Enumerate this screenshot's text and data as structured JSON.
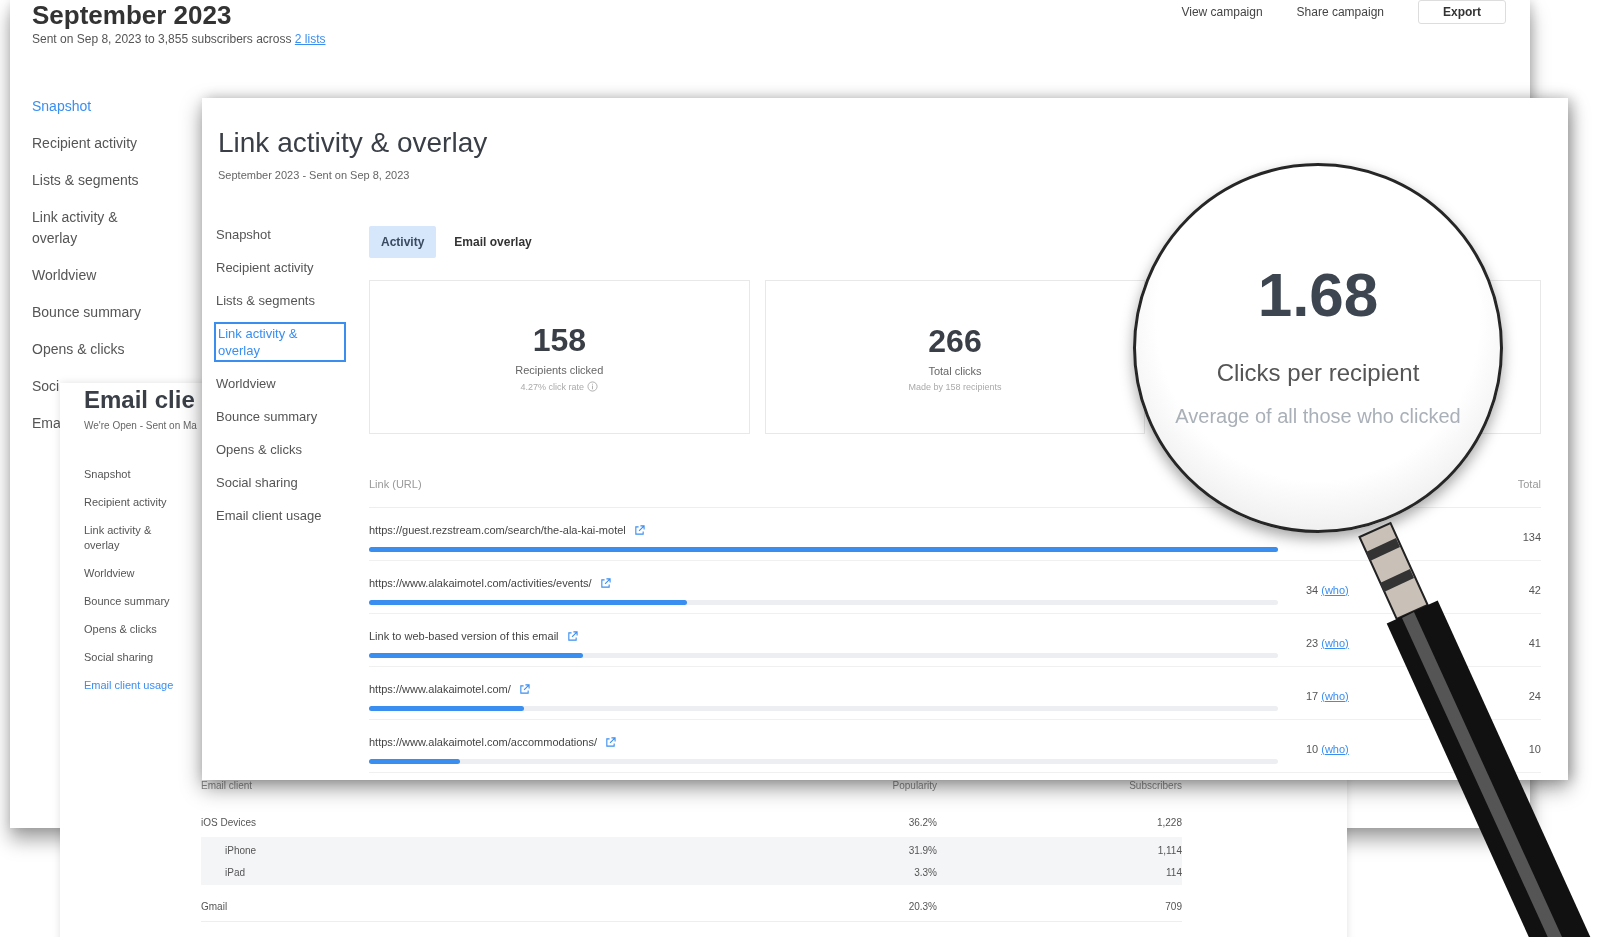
{
  "campaign_report": {
    "title": "September 2023",
    "subtitle": "Sent on Sep 8, 2023 to 3,855 subscribers across ",
    "subtitle_link": "2 lists",
    "actions": [
      "View campaign",
      "Share campaign"
    ],
    "export_button": "Export",
    "nav": [
      {
        "label": "Snapshot",
        "selected": true
      },
      {
        "label": "Recipient activity",
        "selected": false
      },
      {
        "label": "Lists & segments",
        "selected": false
      },
      {
        "label": "Link activity & overlay",
        "selected": false
      },
      {
        "label": "Worldview",
        "selected": false
      },
      {
        "label": "Bounce summary",
        "selected": false
      },
      {
        "label": "Opens & clicks",
        "selected": false
      },
      {
        "label": "Soci",
        "selected": false
      },
      {
        "label": "Ema",
        "selected": false
      }
    ]
  },
  "email_client_report": {
    "title": "Email clie",
    "subtitle": "We're Open - Sent on Ma",
    "nav": [
      {
        "label": "Snapshot",
        "selected": false
      },
      {
        "label": "Recipient activity",
        "selected": false
      },
      {
        "label": "Link activity & overlay",
        "selected": false
      },
      {
        "label": "Worldview",
        "selected": false
      },
      {
        "label": "Bounce summary",
        "selected": false
      },
      {
        "label": "Opens & clicks",
        "selected": false
      },
      {
        "label": "Social sharing",
        "selected": false
      },
      {
        "label": "Email client usage",
        "selected": true
      }
    ],
    "table": {
      "columns": [
        "Email client",
        "Popularity",
        "Subscribers"
      ],
      "rows": [
        {
          "client": "iOS Devices",
          "popularity": "36.2%",
          "subscribers": "1,228",
          "children": [
            {
              "client": "iPhone",
              "popularity": "31.9%",
              "subscribers": "1,114"
            },
            {
              "client": "iPad",
              "popularity": "3.3%",
              "subscribers": "114"
            }
          ]
        },
        {
          "client": "Gmail",
          "popularity": "20.3%",
          "subscribers": "709"
        }
      ]
    }
  },
  "link_activity_report": {
    "title": "Link activity & overlay",
    "subtitle": "September 2023 - Sent on Sep 8, 2023",
    "nav": [
      {
        "label": "Snapshot",
        "selected": false
      },
      {
        "label": "Recipient activity",
        "selected": false
      },
      {
        "label": "Lists & segments",
        "selected": false
      },
      {
        "label": "Link activity & overlay",
        "selected": true
      },
      {
        "label": "Worldview",
        "selected": false
      },
      {
        "label": "Bounce summary",
        "selected": false
      },
      {
        "label": "Opens & clicks",
        "selected": false
      },
      {
        "label": "Social sharing",
        "selected": false
      },
      {
        "label": "Email client usage",
        "selected": false
      }
    ],
    "tabs": [
      {
        "label": "Activity",
        "selected": true
      },
      {
        "label": "Email overlay",
        "selected": false
      }
    ],
    "stats": [
      {
        "value": "158",
        "label": "Recipients clicked",
        "note": "4.27% click rate",
        "info": true
      },
      {
        "value": "266",
        "label": "Total clicks",
        "note": "Made by 158 recipients",
        "info": false
      }
    ],
    "table": {
      "columns": [
        "Link (URL)",
        "Total"
      ],
      "rows": [
        {
          "url": "https://guest.rezstream.com/search/the-ala-kai-motel",
          "level": 1.0,
          "total": "134"
        },
        {
          "url": "https://www.alakaimotel.com/activities/events/",
          "level": 0.35,
          "unique": "34",
          "unique_link": "(who)",
          "total": "42"
        },
        {
          "url": "Link to web-based version of this email",
          "level": 0.235,
          "unique": "23",
          "unique_link": "(who)",
          "total": "41"
        },
        {
          "url": "https://www.alakaimotel.com/",
          "level": 0.17,
          "unique": "17",
          "unique_link": "(who)",
          "total": "24"
        },
        {
          "url": "https://www.alakaimotel.com/accommodations/",
          "level": 0.1,
          "unique": "10",
          "unique_link": "(who)",
          "total": "10"
        }
      ]
    }
  },
  "magnifier": {
    "value": "1.68",
    "label": "Clicks per recipient",
    "note": "Average of all those who clicked"
  }
}
